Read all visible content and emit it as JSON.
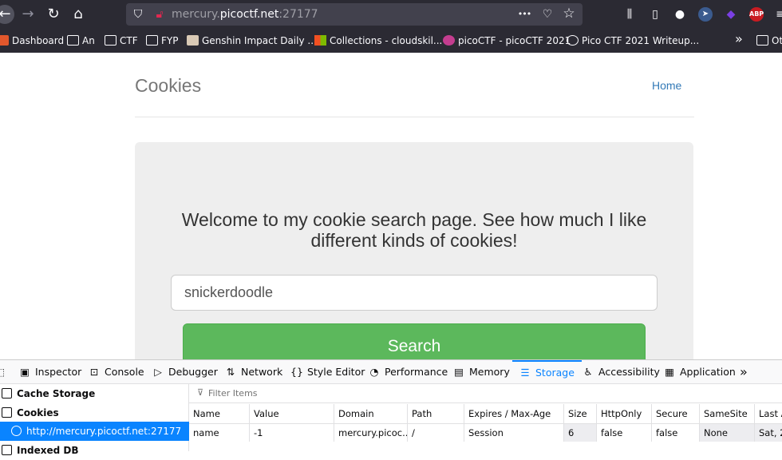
{
  "browser": {
    "url_host_prefix": "mercury.",
    "url_host_main": "picoctf.net",
    "url_port": ":27177",
    "more_glyph": "•••",
    "abp_label": "ABP"
  },
  "bookmarks": [
    {
      "label": "Dashboard",
      "icon": "dashboard-icon"
    },
    {
      "label": "An",
      "icon": "folder-icon"
    },
    {
      "label": "CTF",
      "icon": "folder-icon"
    },
    {
      "label": "FYP",
      "icon": "folder-icon"
    },
    {
      "label": "Genshin Impact Daily ...",
      "icon": "genshin-icon"
    },
    {
      "label": "Collections - cloudskil...",
      "icon": "microsoft-icon"
    },
    {
      "label": "picoCTF - picoCTF 2021",
      "icon": "picoctf-icon"
    },
    {
      "label": "Pico CTF 2021 Writeup...",
      "icon": "globe-icon"
    }
  ],
  "bookmarks_overflow": "»",
  "other_bookmarks": "Ot",
  "page": {
    "title": "Cookies",
    "nav_home": "Home",
    "welcome": "Welcome to my cookie search page. See how much I like different kinds of cookies!",
    "search_value": "snickerdoodle",
    "search_button": "Search"
  },
  "devtools": {
    "tabs": [
      {
        "label": "Inspector",
        "icon": "inspector-icon"
      },
      {
        "label": "Console",
        "icon": "console-icon"
      },
      {
        "label": "Debugger",
        "icon": "debugger-icon"
      },
      {
        "label": "Network",
        "icon": "network-icon"
      },
      {
        "label": "Style Editor",
        "icon": "style-editor-icon"
      },
      {
        "label": "Performance",
        "icon": "performance-icon"
      },
      {
        "label": "Memory",
        "icon": "memory-icon"
      },
      {
        "label": "Storage",
        "icon": "storage-icon",
        "active": true
      },
      {
        "label": "Accessibility",
        "icon": "accessibility-icon"
      },
      {
        "label": "Application",
        "icon": "application-icon"
      }
    ],
    "tabs_overflow": "»",
    "storage_tree": [
      {
        "label": "Cache Storage"
      },
      {
        "label": "Cookies"
      },
      {
        "label": "http://mercury.picoctf.net:27177",
        "selected": true
      },
      {
        "label": "Indexed DB"
      }
    ],
    "filter_placeholder": "Filter Items",
    "columns": [
      "Name",
      "Value",
      "Domain",
      "Path",
      "Expires / Max-Age",
      "Size",
      "HttpOnly",
      "Secure",
      "SameSite",
      "Last Ac"
    ],
    "rows": [
      [
        "name",
        "-1",
        "mercury.picoc...",
        "/",
        "Session",
        "6",
        "false",
        "false",
        "None",
        "Sat, 2"
      ]
    ]
  },
  "colors": {
    "chrome_bg": "#2b2a33",
    "accent": "#0a84ff",
    "search_green": "#5cb85c",
    "link_blue": "#337ab7"
  }
}
